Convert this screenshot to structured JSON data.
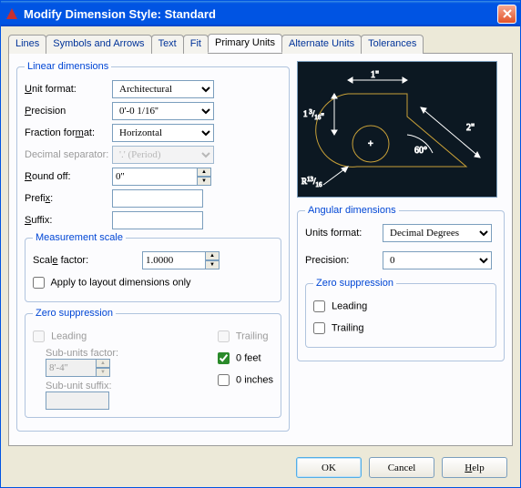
{
  "window": {
    "title": "Modify Dimension Style: Standard"
  },
  "tabs": {
    "lines": "Lines",
    "symbols": "Symbols and Arrows",
    "text": "Text",
    "fit": "Fit",
    "primary": "Primary Units",
    "alternate": "Alternate Units",
    "tolerances": "Tolerances"
  },
  "linear": {
    "legend": "Linear dimensions",
    "unit_format_label": "Unit format:",
    "unit_format": "Architectural",
    "precision_label": "Precision",
    "precision": "0'-0 1/16''",
    "fraction_label": "Fraction format:",
    "fraction": "Horizontal",
    "decimal_sep_label": "Decimal separator:",
    "decimal_sep": "'.' (Period)",
    "roundoff_label": "Round off:",
    "roundoff": "0''",
    "prefix_label": "Prefix:",
    "prefix": "",
    "suffix_label": "Suffix:",
    "suffix": ""
  },
  "measure": {
    "legend": "Measurement scale",
    "scale_label": "Scale factor:",
    "scale": "1.0000",
    "apply_layout": "Apply to layout dimensions only"
  },
  "zero_l": {
    "legend": "Zero suppression",
    "leading": "Leading",
    "subunits_factor_label": "Sub-units factor:",
    "subunits_factor": "8'-4''",
    "subunit_suffix_label": "Sub-unit suffix:",
    "subunit_suffix": "",
    "trailing": "Trailing",
    "zero_feet": "0 feet",
    "zero_inches": "0 inches"
  },
  "angular": {
    "legend": "Angular dimensions",
    "units_format_label": "Units format:",
    "units_format": "Decimal Degrees",
    "precision_label": "Precision:",
    "precision": "0"
  },
  "zero_a": {
    "legend": "Zero suppression",
    "leading": "Leading",
    "trailing": "Trailing"
  },
  "preview": {
    "dim1": "1\"",
    "dim2": "2\"",
    "dim3": "1 3/16\"",
    "dim4": "R 13/16",
    "angle": "60°"
  },
  "buttons": {
    "ok": "OK",
    "cancel": "Cancel",
    "help": "Help"
  }
}
